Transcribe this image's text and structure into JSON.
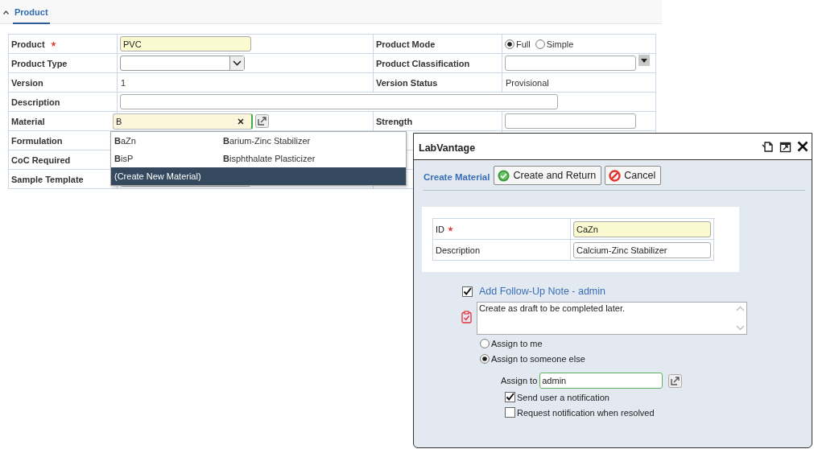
{
  "section_tab": {
    "label": "Product",
    "expanded": true,
    "selected": true
  },
  "form": {
    "rows": [
      {
        "left": {
          "label": "Product",
          "required": true,
          "kind": "input",
          "value": "PVC"
        },
        "right": {
          "label": "Product Mode",
          "kind": "radio",
          "options": [
            {
              "label": "Full",
              "selected": true
            },
            {
              "label": "Simple",
              "selected": false
            }
          ]
        }
      },
      {
        "left": {
          "label": "Product Type",
          "kind": "select"
        },
        "right": {
          "label": "Product Classification",
          "kind": "combo"
        }
      },
      {
        "left": {
          "label": "Version",
          "kind": "text",
          "value": "1"
        },
        "right": {
          "label": "Version Status",
          "kind": "text",
          "value": "Provisional"
        }
      },
      {
        "left": {
          "label": "Description",
          "kind": "input",
          "wide": true
        }
      },
      {
        "left": {
          "label": "Material",
          "kind": "lookup",
          "value": "B",
          "focused": true
        },
        "right": {
          "label": "Strength",
          "kind": "input"
        }
      },
      {
        "left": {
          "label": "Formulation",
          "kind": "hidden"
        }
      },
      {
        "left": {
          "label": "CoC Required",
          "kind": "hidden"
        }
      },
      {
        "left": {
          "label": "Sample Template",
          "kind": "input"
        }
      }
    ]
  },
  "autocomplete": {
    "items": [
      {
        "id": "**B**aZn",
        "description": "**B**arium-Zinc Stabilizer",
        "selected": false
      },
      {
        "id": "**B**isP",
        "description": "**B**isphthalate Plasticizer",
        "selected": false
      }
    ],
    "create_option": {
      "label": "(Create New Material)",
      "selected": true
    }
  },
  "dialog": {
    "title": "LabVantage",
    "heading": "Create Material",
    "buttons": [
      {
        "label": "Create and Return",
        "kind": "confirm"
      },
      {
        "label": "Cancel",
        "kind": "cancel"
      }
    ],
    "fields": [
      {
        "label": "ID",
        "required": true,
        "value": "CaZn"
      },
      {
        "label": "Description",
        "required": false,
        "value": "Calcium-Zinc Stabilizer"
      }
    ],
    "follow_up": {
      "checked": true,
      "label": "Add Follow-Up Note - admin",
      "note": "Create as draft to be completed later.",
      "assign_options": [
        {
          "label": "Assign to me",
          "selected": false
        },
        {
          "label": "Assign to someone else",
          "selected": true
        }
      ],
      "assign_to": {
        "label": "Assign to",
        "value": "admin"
      },
      "options": [
        {
          "label": "Send user a notification",
          "checked": true
        },
        {
          "label": "Request notification when resolved",
          "checked": false
        }
      ]
    }
  }
}
